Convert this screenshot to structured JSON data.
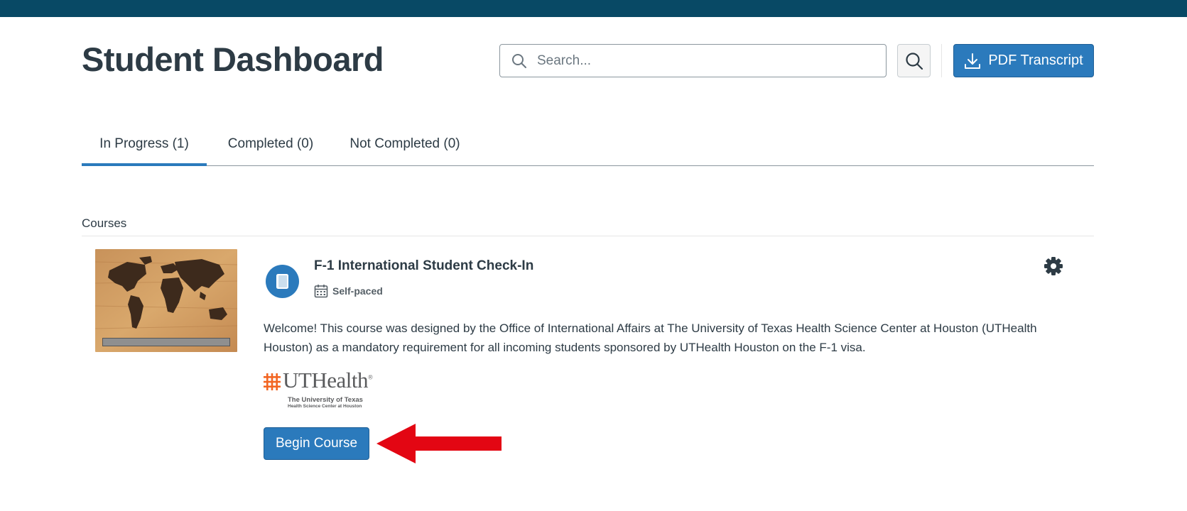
{
  "header": {
    "title": "Student Dashboard",
    "search_placeholder": "Search...",
    "pdf_button": "PDF Transcript"
  },
  "tabs": [
    {
      "label": "In Progress (1)",
      "active": true
    },
    {
      "label": "Completed (0)",
      "active": false
    },
    {
      "label": "Not Completed (0)",
      "active": false
    }
  ],
  "courses": {
    "section_label": "Courses",
    "items": [
      {
        "title": "F-1 International Student Check-In",
        "pace": "Self-paced",
        "description": "Welcome! This course was designed by the Office of International Affairs at The University of Texas Health Science Center at Houston (UTHealth Houston) as a mandatory requirement for all incoming students sponsored by UTHealth Houston on the F-1 visa.",
        "logo": {
          "name": "UTHealth",
          "registered": "®",
          "line1": "The University of Texas",
          "line2": "Health Science Center at Houston"
        },
        "action_button": "Begin Course"
      }
    ]
  },
  "icons": {
    "search": "search-icon",
    "download": "download-icon",
    "course_type": "book-icon",
    "calendar": "calendar-icon",
    "settings": "gear-icon"
  },
  "colors": {
    "topbar": "#084965",
    "primary": "#2b7abc",
    "text": "#2d3b45",
    "annotation_arrow": "#e30613",
    "logo_orange": "#f26522"
  }
}
